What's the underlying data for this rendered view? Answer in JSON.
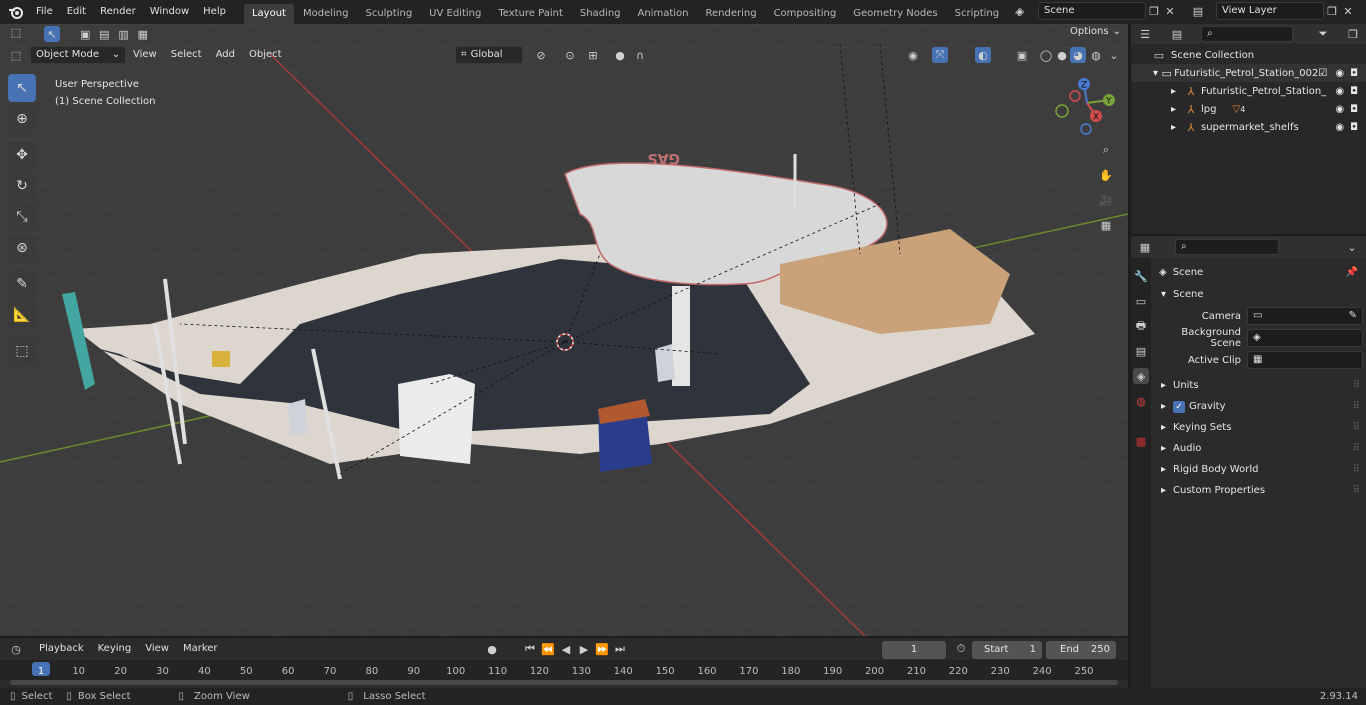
{
  "app": {
    "version": "2.93.14"
  },
  "top_menu": [
    "File",
    "Edit",
    "Render",
    "Window",
    "Help"
  ],
  "workspace_tabs": [
    {
      "label": "Layout",
      "active": true
    },
    {
      "label": "Modeling"
    },
    {
      "label": "Sculpting"
    },
    {
      "label": "UV Editing"
    },
    {
      "label": "Texture Paint"
    },
    {
      "label": "Shading"
    },
    {
      "label": "Animation"
    },
    {
      "label": "Rendering"
    },
    {
      "label": "Compositing"
    },
    {
      "label": "Geometry Nodes"
    },
    {
      "label": "Scripting"
    }
  ],
  "scene_selector": {
    "value": "Scene"
  },
  "view_layer_selector": {
    "value": "View Layer"
  },
  "viewport_header": {
    "mode": "Object Mode",
    "menus": [
      "View",
      "Select",
      "Add",
      "Object"
    ],
    "transform_orientation": "Global",
    "options_label": "Options"
  },
  "viewport": {
    "perspective_label": "User Perspective",
    "collection_label": "(1) Scene Collection",
    "sign_text": "GAS",
    "gizmo_axes": [
      "X",
      "Y",
      "Z"
    ]
  },
  "toolbar_tools": [
    "select-box",
    "cursor",
    "move",
    "rotate",
    "scale",
    "transform",
    "annotate",
    "measure",
    "add-cube"
  ],
  "outliner": {
    "root": "Scene Collection",
    "items": [
      {
        "label": "Futuristic_Petrol_Station_002",
        "level": 1,
        "expanded": true
      },
      {
        "label": "Futuristic_Petrol_Station_",
        "level": 2
      },
      {
        "label": "lpg",
        "level": 2,
        "badge": "4"
      },
      {
        "label": "supermarket_shelfs",
        "level": 2
      }
    ]
  },
  "properties": {
    "breadcrumb": "Scene",
    "panel": "Scene",
    "fields": [
      {
        "label": "Camera",
        "value": ""
      },
      {
        "label": "Background Scene",
        "value": ""
      },
      {
        "label": "Active Clip",
        "value": ""
      }
    ],
    "collapsed_panels": [
      "Units",
      "Gravity",
      "Keying Sets",
      "Audio",
      "Rigid Body World",
      "Custom Properties"
    ],
    "gravity_checked": true
  },
  "timeline": {
    "menus": [
      "Playback",
      "Keying",
      "View",
      "Marker"
    ],
    "current_frame": "1",
    "start_label": "Start",
    "start_value": "1",
    "end_label": "End",
    "end_value": "250",
    "ruler": [
      "1",
      "10",
      "20",
      "30",
      "40",
      "50",
      "60",
      "70",
      "80",
      "90",
      "100",
      "110",
      "120",
      "130",
      "140",
      "150",
      "160",
      "170",
      "180",
      "190",
      "200",
      "210",
      "220",
      "230",
      "240",
      "250"
    ]
  },
  "statusbar": {
    "items": [
      "Select",
      "Box Select",
      "Zoom View",
      "Lasso Select"
    ]
  }
}
